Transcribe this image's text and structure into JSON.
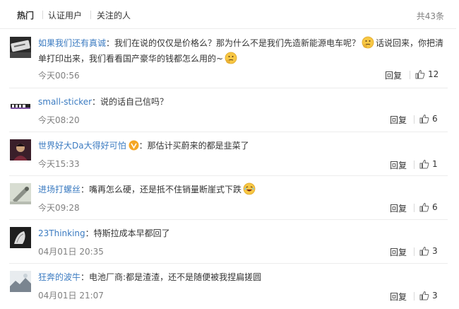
{
  "tabs": [
    {
      "label": "热门"
    },
    {
      "label": "认证用户"
    },
    {
      "label": "关注的人"
    }
  ],
  "total_count": "共43条",
  "reply_label": "回复",
  "comments": [
    {
      "user": "如果我们还有真诚",
      "text_a": "我们在说的仅仅是价格么？那为什么不是我们先造新能源电车呢？",
      "text_b": "话说回来，你把清单打印出来，我们看看国产豪华的钱都怎么用的~",
      "time": "今天00:56",
      "likes": "12",
      "emoji_a": "thinking-emoji",
      "emoji_b": "thinking-emoji"
    },
    {
      "user": "small-sticker",
      "text": "说的话自己信吗？",
      "time": "今天08:20",
      "likes": "6"
    },
    {
      "user": "世界好大Da大得好可怕",
      "text": "那估计买蔚来的都是韭菜了",
      "time": "今天15:33",
      "likes": "1",
      "badge": "verified-badge"
    },
    {
      "user": "进场打螺丝",
      "text": "嘴再怎么硬，还是抵不住销量断崖式下跌",
      "time": "今天09:28",
      "likes": "6",
      "emoji": "laughing-emoji"
    },
    {
      "user": "23Thinking",
      "text": "特斯拉成本早都回了",
      "time": "04月01日 20:35",
      "likes": "3"
    },
    {
      "user": "狂奔的波牛",
      "text": "电池厂商:都是渣渣，还不是随便被我捏扁搓圆",
      "time": "04月01日 21:07",
      "likes": "3"
    }
  ],
  "colors": {
    "link": "#3b7bc1",
    "muted": "#808080",
    "divider": "#ececec",
    "badge": "#f5a623"
  }
}
